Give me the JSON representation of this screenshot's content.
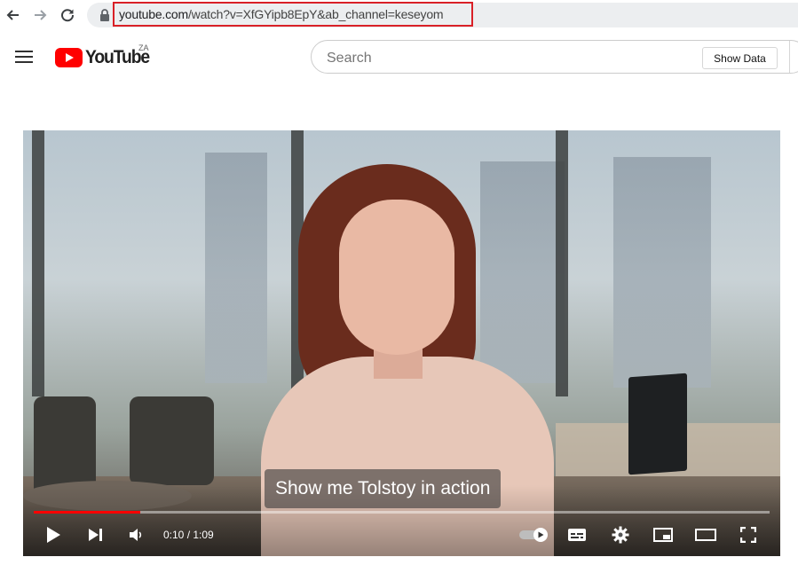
{
  "browser": {
    "url_host": "youtube.com",
    "url_path": "/watch?v=XfGYipb8EpY&ab_channel=keseyom"
  },
  "header": {
    "logo_text": "YouTube",
    "country_code": "ZA",
    "search_placeholder": "Search",
    "show_data_label": "Show Data"
  },
  "player": {
    "caption": "Show me Tolstoy in action",
    "time_current": "0:10",
    "time_separator": " / ",
    "time_total": "1:09",
    "progress_fraction": 0.145
  },
  "colors": {
    "accent": "#ff0000",
    "highlight_box": "#d92027"
  }
}
